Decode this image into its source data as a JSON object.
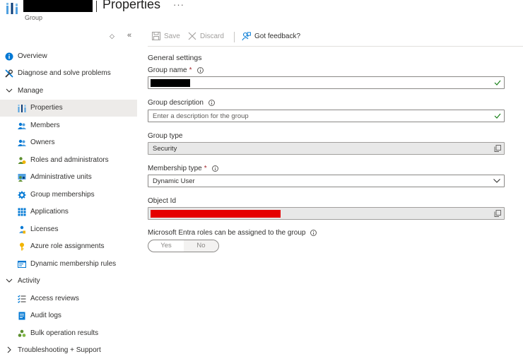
{
  "header": {
    "title": "Properties",
    "subtitle": "Group",
    "more": "···"
  },
  "sidebar": {
    "controls": {
      "sort": "◇",
      "collapse": "«"
    },
    "items": [
      {
        "label": "Overview",
        "icon": "info-icon"
      },
      {
        "label": "Diagnose and solve problems",
        "icon": "wrench-icon"
      },
      {
        "label": "Manage",
        "icon": "chevron-down-icon",
        "expanded": true
      },
      {
        "label": "Properties",
        "icon": "properties-icon",
        "selected": true
      },
      {
        "label": "Members",
        "icon": "members-icon"
      },
      {
        "label": "Owners",
        "icon": "owners-icon"
      },
      {
        "label": "Roles and administrators",
        "icon": "roles-icon"
      },
      {
        "label": "Administrative units",
        "icon": "admin-units-icon"
      },
      {
        "label": "Group memberships",
        "icon": "gear-icon"
      },
      {
        "label": "Applications",
        "icon": "apps-grid-icon"
      },
      {
        "label": "Licenses",
        "icon": "licenses-icon"
      },
      {
        "label": "Azure role assignments",
        "icon": "key-icon"
      },
      {
        "label": "Dynamic membership rules",
        "icon": "rules-icon"
      },
      {
        "label": "Activity",
        "icon": "chevron-down-icon",
        "expanded": true
      },
      {
        "label": "Access reviews",
        "icon": "checklist-icon"
      },
      {
        "label": "Audit logs",
        "icon": "log-icon"
      },
      {
        "label": "Bulk operation results",
        "icon": "bulk-icon"
      },
      {
        "label": "Troubleshooting + Support",
        "icon": "chevron-right-icon",
        "expanded": false
      }
    ]
  },
  "toolbar": {
    "save_label": "Save",
    "discard_label": "Discard",
    "feedback_label": "Got feedback?"
  },
  "form": {
    "section_title": "General settings",
    "group_name": {
      "label": "Group name",
      "required": "*",
      "value_redacted": true
    },
    "group_description": {
      "label": "Group description",
      "placeholder": "Enter a description for the group"
    },
    "group_type": {
      "label": "Group type",
      "value": "Security"
    },
    "membership_type": {
      "label": "Membership type",
      "required": "*",
      "value": "Dynamic User"
    },
    "object_id": {
      "label": "Object Id",
      "value_redacted": true
    },
    "entra_roles": {
      "label": "Microsoft Entra roles can be assigned to the group",
      "yes": "Yes",
      "no": "No",
      "selected": "No"
    }
  },
  "colors": {
    "accent": "#0078d4",
    "valid_check": "#107c10",
    "selected_nav_bg": "#edebe9",
    "redaction_red": "#e50000"
  }
}
